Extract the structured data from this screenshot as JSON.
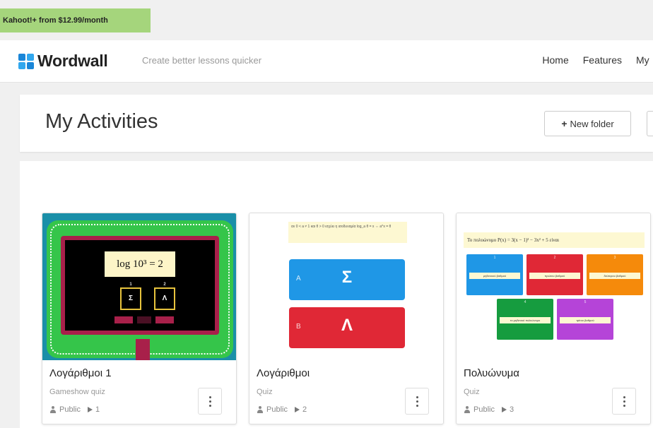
{
  "promo": {
    "text": "Kahoot!+ from $12.99/month"
  },
  "header": {
    "logo_text": "Wordwall",
    "tagline": "Create better lessons quicker",
    "nav": [
      "Home",
      "Features",
      "My"
    ]
  },
  "page": {
    "title": "My Activities",
    "new_folder_label": "New folder"
  },
  "activities": [
    {
      "title": "Λογάριθμοι 1",
      "type": "Gameshow quiz",
      "visibility": "Public",
      "plays": "1",
      "thumb": {
        "question": "log 10³ = 2",
        "options": [
          "Σ",
          "Λ"
        ],
        "option_numbers": [
          "1",
          "2"
        ]
      }
    },
    {
      "title": "Λογάριθμοι",
      "type": "Quiz",
      "visibility": "Public",
      "plays": "2",
      "thumb": {
        "question": "αν 0 < a ≠ 1 και θ > 0 ισχύει η ισοδυναμία log_a θ = x ⇔ a^x = θ",
        "options": [
          {
            "letter": "A",
            "symbol": "Σ"
          },
          {
            "letter": "B",
            "symbol": "Λ"
          }
        ],
        "colors": {
          "a": "#1f97e6",
          "b": "#e02836"
        }
      }
    },
    {
      "title": "Πολυώνυμα",
      "type": "Quiz",
      "visibility": "Public",
      "plays": "3",
      "thumb": {
        "question": "Το πολυώνυμο P(x) = 3(x − 1)² − 3x² + 5 είναι",
        "boxes": [
          {
            "num": "1",
            "label": "μηδενικού βαθμού",
            "color": "#1f97e6"
          },
          {
            "num": "2",
            "label": "πρώτου βαθμού",
            "color": "#e02836"
          },
          {
            "num": "3",
            "label": "δεύτερου βαθμού",
            "color": "#f58a0b"
          },
          {
            "num": "4",
            "label": "το μηδενικό πολυώνυμο",
            "color": "#169c3f"
          },
          {
            "num": "5",
            "label": "τρίτου βαθμού",
            "color": "#b544d8"
          }
        ]
      }
    }
  ]
}
